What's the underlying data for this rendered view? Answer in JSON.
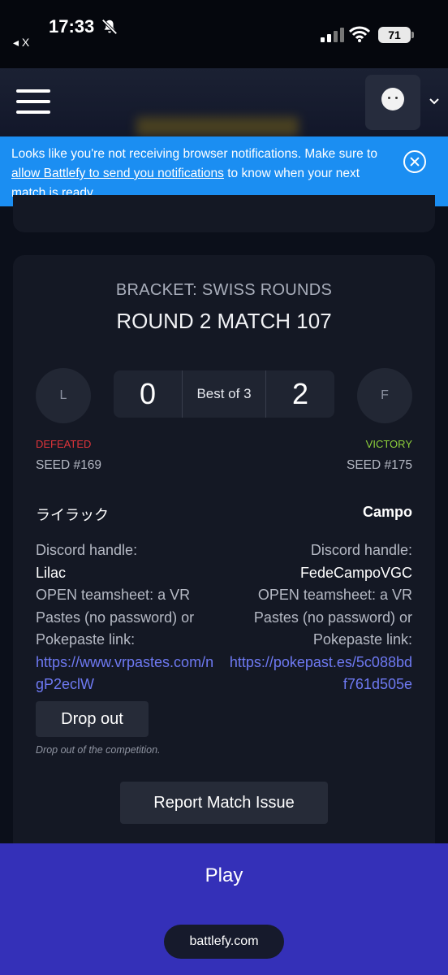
{
  "status_bar": {
    "time": "17:33",
    "back_app": "◂ X",
    "battery": "71"
  },
  "banner": {
    "text_before": "Looks like you're not receiving browser notifications. Make sure to ",
    "link_text": "allow Battlefy to send you notifications",
    "text_after": " to know when your next match is ready."
  },
  "match": {
    "bracket": "BRACKET: SWISS ROUNDS",
    "round": "ROUND 2 MATCH 107",
    "format": "Best of 3",
    "left": {
      "initial": "L",
      "score": "0",
      "result": "DEFEATED",
      "seed": "SEED #169",
      "name": "ライラック",
      "discord_label": "Discord handle:",
      "discord_handle": "Lilac",
      "teamsheet_label": "OPEN teamsheet: a VR Pastes (no password) or Pokepaste link:",
      "teamsheet_link": "https://www.vrpastes.com/ngP2eclW"
    },
    "right": {
      "initial": "F",
      "score": "2",
      "result": "VICTORY",
      "seed": "SEED #175",
      "name": "Campo",
      "discord_label": "Discord handle:",
      "discord_handle": "FedeCampoVGC",
      "teamsheet_label": "OPEN teamsheet: a VR Pastes (no password) or Pokepaste link:",
      "teamsheet_link": "https://pokepast.es/5c088bdf761d505e"
    },
    "drop_button": "Drop out",
    "drop_note": "Drop out of the competition.",
    "report_button": "Report Match Issue"
  },
  "footer": {
    "play": "Play",
    "url": "battlefy.com"
  },
  "colors": {
    "background": "#0b0f1a",
    "card": "#141824",
    "banner": "#1b8ef2",
    "defeated": "#e0343a",
    "victory": "#8ed13b",
    "link": "#6e79f2",
    "play_bar": "#3430b8"
  },
  "icons": [
    "bell-off-icon",
    "signal-icon",
    "wifi-icon",
    "battery-icon",
    "menu-icon",
    "avatar",
    "chevron-down-icon",
    "close-icon"
  ]
}
